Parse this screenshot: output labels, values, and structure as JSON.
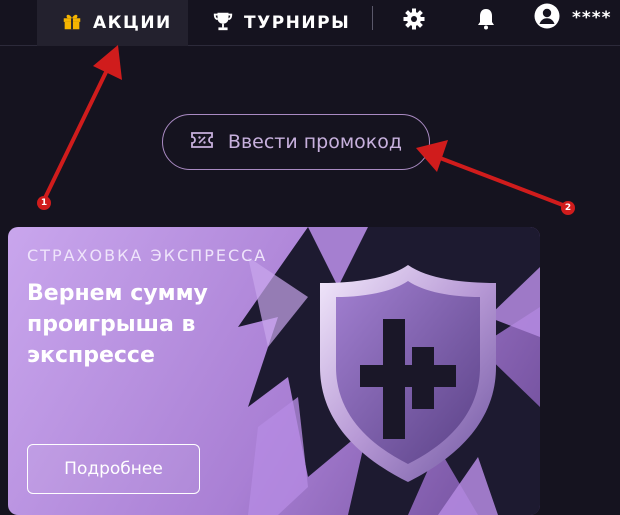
{
  "nav": {
    "promotions_label": "АКЦИИ",
    "tournaments_label": "ТУРНИРЫ",
    "username": "****"
  },
  "promo_button": {
    "label": "Ввести промокод"
  },
  "banner": {
    "eyebrow": "СТРАХОВКА ЭКСПРЕССА",
    "title": "Вернем сумму проигрыша в экспрессе",
    "button_label": "Подробнее"
  },
  "annotations": {
    "marker_1": "1",
    "marker_2": "2",
    "color": "#d01c1c"
  },
  "colors": {
    "background": "#15131f",
    "accent_gold": "#f5b400",
    "banner_purple": "#b58be2"
  }
}
